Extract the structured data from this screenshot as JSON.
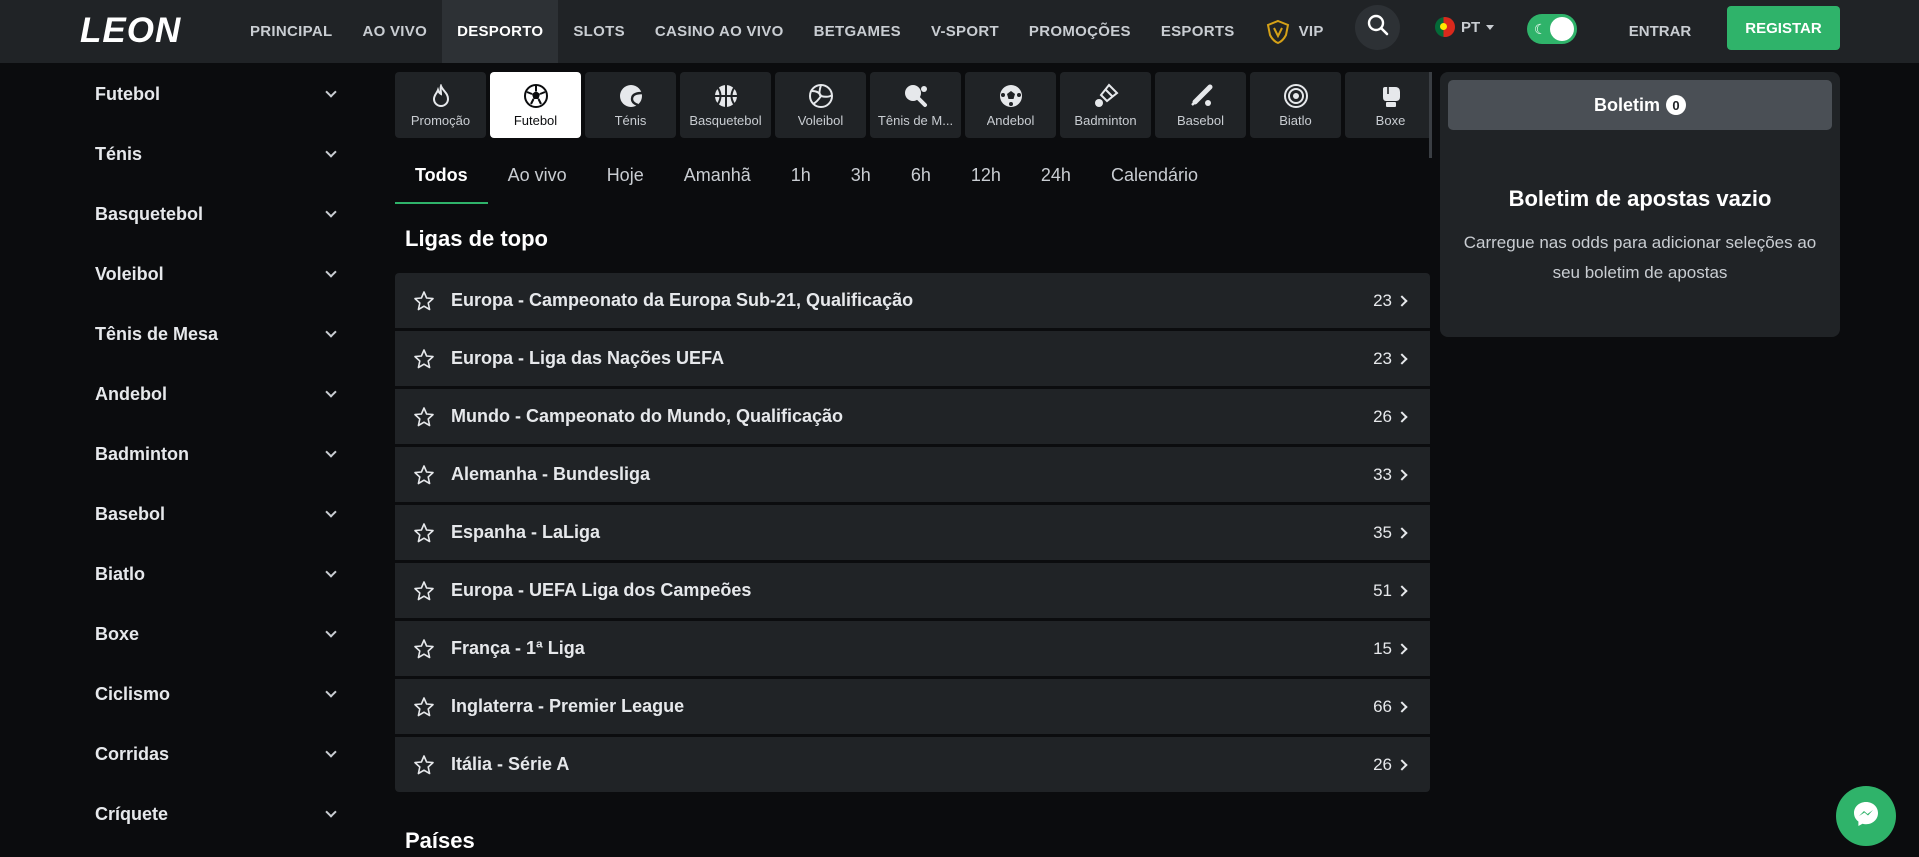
{
  "brand": {
    "logo": "LEON"
  },
  "nav": {
    "items": [
      {
        "label": "PRINCIPAL"
      },
      {
        "label": "AO VIVO"
      },
      {
        "label": "DESPORTO"
      },
      {
        "label": "SLOTS"
      },
      {
        "label": "CASINO AO VIVO"
      },
      {
        "label": "BETGAMES"
      },
      {
        "label": "V-SPORT"
      },
      {
        "label": "PROMOÇÕES"
      },
      {
        "label": "ESPORTS"
      },
      {
        "label": "VIP"
      }
    ],
    "active": "DESPORTO",
    "more": "•••"
  },
  "header": {
    "language": "PT",
    "login_label": "ENTRAR",
    "register_label": "REGISTAR"
  },
  "colors": {
    "accent": "#2fb36a",
    "header_bg": "#202326",
    "page_bg": "#0b0c0e",
    "vip_gold": "#d4a017"
  },
  "sidebar": {
    "items": [
      {
        "label": "Futebol"
      },
      {
        "label": "Ténis"
      },
      {
        "label": "Basquetebol"
      },
      {
        "label": "Voleibol"
      },
      {
        "label": "Tênis de Mesa"
      },
      {
        "label": "Andebol"
      },
      {
        "label": "Badminton"
      },
      {
        "label": "Basebol"
      },
      {
        "label": "Biatlo"
      },
      {
        "label": "Boxe"
      },
      {
        "label": "Ciclismo"
      },
      {
        "label": "Corridas"
      },
      {
        "label": "Críquete"
      }
    ]
  },
  "sports": {
    "items": [
      {
        "label": "Promoção",
        "icon": "flame-icon"
      },
      {
        "label": "Futebol",
        "icon": "soccer-ball-icon"
      },
      {
        "label": "Ténis",
        "icon": "tennis-ball-icon"
      },
      {
        "label": "Basquetebol",
        "icon": "basketball-icon"
      },
      {
        "label": "Voleibol",
        "icon": "volleyball-icon"
      },
      {
        "label": "Tênis de M...",
        "icon": "table-tennis-icon"
      },
      {
        "label": "Andebol",
        "icon": "handball-icon"
      },
      {
        "label": "Badminton",
        "icon": "shuttlecock-icon"
      },
      {
        "label": "Basebol",
        "icon": "baseball-bat-icon"
      },
      {
        "label": "Biatlo",
        "icon": "target-icon"
      },
      {
        "label": "Boxe",
        "icon": "boxing-glove-icon"
      }
    ],
    "active": "Futebol"
  },
  "time_tabs": {
    "items": [
      {
        "label": "Todos"
      },
      {
        "label": "Ao vivo"
      },
      {
        "label": "Hoje"
      },
      {
        "label": "Amanhã"
      },
      {
        "label": "1h"
      },
      {
        "label": "3h"
      },
      {
        "label": "6h"
      },
      {
        "label": "12h"
      },
      {
        "label": "24h"
      },
      {
        "label": "Calendário"
      }
    ],
    "active": "Todos"
  },
  "top_leagues": {
    "title": "Ligas de topo",
    "items": [
      {
        "name": "Europa - Campeonato da Europa Sub-21, Qualificação",
        "count": "23"
      },
      {
        "name": "Europa - Liga das Nações UEFA",
        "count": "23"
      },
      {
        "name": "Mundo - Campeonato do Mundo, Qualificação",
        "count": "26"
      },
      {
        "name": "Alemanha - Bundesliga",
        "count": "33"
      },
      {
        "name": "Espanha - LaLiga",
        "count": "35"
      },
      {
        "name": "Europa - UEFA Liga dos Campeões",
        "count": "51"
      },
      {
        "name": "França - 1ª Liga",
        "count": "15"
      },
      {
        "name": "Inglaterra - Premier League",
        "count": "66"
      },
      {
        "name": "Itália - Série A",
        "count": "26"
      }
    ]
  },
  "countries": {
    "title": "Países"
  },
  "betslip": {
    "button_label": "Boletim",
    "count": "0",
    "empty_title": "Boletim de apostas vazio",
    "empty_text": "Carregue nas odds para adicionar seleções ao seu boletim de apostas"
  }
}
